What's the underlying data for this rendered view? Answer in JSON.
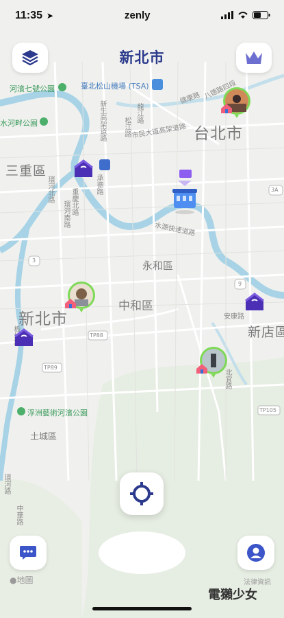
{
  "status_bar": {
    "time": "11:35",
    "app_name": "zenly"
  },
  "header": {
    "title": "新北市"
  },
  "map": {
    "cities": [
      {
        "key": "taipei",
        "text": "台北市"
      },
      {
        "key": "sanchong",
        "text": "三重區"
      },
      {
        "key": "newtaipei",
        "text": "新北市"
      },
      {
        "key": "xindian",
        "text": "新店區"
      }
    ],
    "districts": [
      {
        "key": "yonghe",
        "text": "永和區"
      },
      {
        "key": "zhonghe",
        "text": "中和區"
      },
      {
        "key": "tucheng",
        "text": "土城區"
      }
    ],
    "pois": [
      {
        "key": "songshan",
        "text": "臺北松山機場 (TSA)"
      },
      {
        "key": "riverside7",
        "text": "河濱七號公園"
      },
      {
        "key": "riverside",
        "text": "水河畔公園"
      },
      {
        "key": "fuzhou",
        "text": "浮洲藝術河濱公園"
      }
    ],
    "roads": [
      "健康路",
      "八德路四段",
      "龍江路",
      "松江路",
      "市民大道高架道路",
      "新生高架道路",
      "環河北路",
      "重慶北路",
      "承德路",
      "水源快速道路",
      "安康路",
      "北宜路",
      "板城路",
      "環河南路",
      "環河路",
      "中華路"
    ],
    "shields": [
      "TP88",
      "TP89",
      "TP105",
      "3",
      "9",
      "3A"
    ],
    "attribution": "地圖",
    "legal": "法律資訊"
  },
  "watermark": "電獺少女",
  "colors": {
    "title": "#2b3a8c",
    "accent": "#2b3a8c",
    "friend_ring": "#7ed957",
    "house": "#4b2fb4",
    "water": "#aed6e8"
  },
  "icons": {
    "layers": "layers-icon",
    "crown": "crown-icon",
    "locate": "crosshair-icon",
    "chat": "chat-icon",
    "profile": "profile-icon"
  }
}
